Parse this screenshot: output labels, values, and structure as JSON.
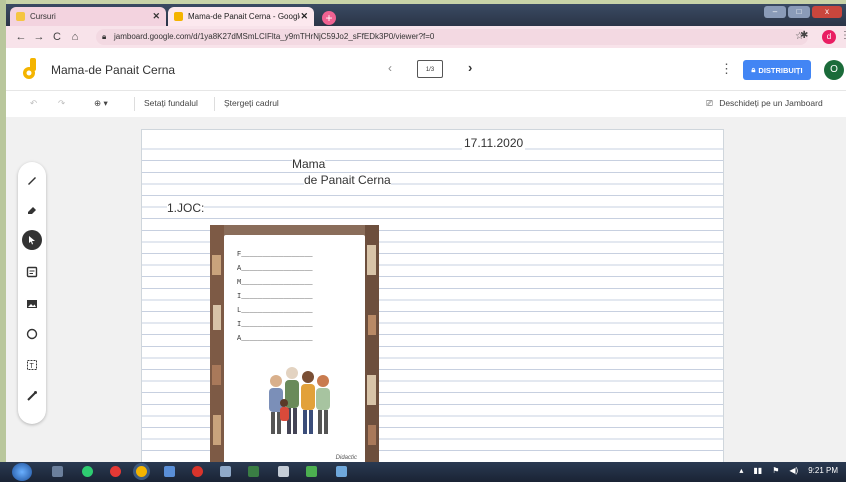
{
  "browser": {
    "tabs": [
      {
        "title": "Cursuri",
        "favicon_color": "#f5c542"
      },
      {
        "title": "Mama-de Panait Cerna - Google J",
        "favicon_color": "#f4b400"
      }
    ],
    "new_tab": "+",
    "window_controls": {
      "minimize": "–",
      "maximize": "□",
      "close": "x"
    },
    "url": "jamboard.google.com/d/1ya8K27dMSmLCIFlta_y9mTHrNjC59Jo2_sFfEDk3P0/viewer?f=0",
    "profile_initial": "d"
  },
  "app": {
    "doc_title": "Mama-de Panait Cerna",
    "frame_indicator": "1/3",
    "share_label": "DISTRIBUIȚI",
    "account_initial": "O",
    "brand_color": "#f4b400",
    "accent_color": "#4285f4"
  },
  "toolbar": {
    "set_background": "Setați fundalul",
    "clear_frame": "Ștergeți cadrul",
    "open_jamboard": "Deschideți pe un Jamboard"
  },
  "sidetools": [
    "pen-icon",
    "eraser-icon",
    "select-icon",
    "sticky-note-icon",
    "image-icon",
    "circle-icon",
    "text-box-icon",
    "laser-icon"
  ],
  "canvas": {
    "date": "17.11.2020",
    "title_line1": "Mama",
    "title_line2": "de Panait Cerna",
    "activity": "1.JOC:",
    "acrostic": [
      "F",
      "A",
      "M",
      "I",
      "L",
      "I",
      "A"
    ],
    "signature": "Didactic"
  },
  "taskbar": {
    "time": "9:21 PM"
  }
}
